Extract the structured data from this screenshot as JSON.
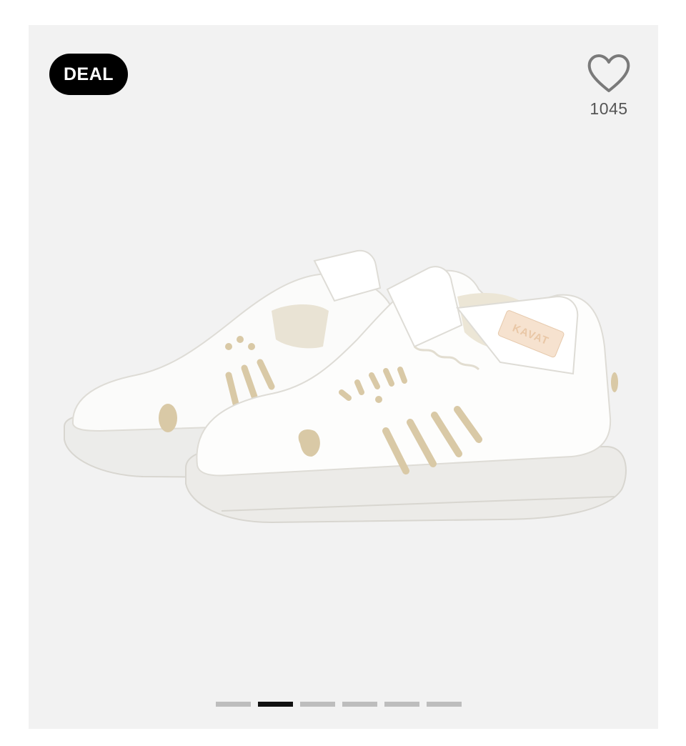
{
  "badge": {
    "label": "DEAL"
  },
  "favorite": {
    "icon": "heart-outline-icon",
    "count": "1045"
  },
  "product_image": {
    "logo_text": "KAVAT"
  },
  "carousel": {
    "total": 6,
    "active_index": 1
  },
  "colors": {
    "badge_bg": "#000000",
    "gallery_bg": "#f2f2f2",
    "dot_active": "#111111",
    "dot_inactive": "#bdbdbd"
  }
}
